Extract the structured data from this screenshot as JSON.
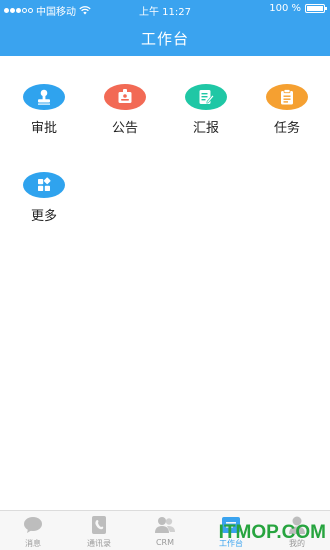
{
  "status_bar": {
    "carrier": "中国移动",
    "time": "上午 11:27",
    "battery": "100 %"
  },
  "header": {
    "title": "工作台"
  },
  "apps": [
    {
      "label": "审批",
      "icon": "stamp-icon",
      "color": "#2fa3ee"
    },
    {
      "label": "公告",
      "icon": "badge-icon",
      "color": "#f26a55"
    },
    {
      "label": "汇报",
      "icon": "report-icon",
      "color": "#1fc7a5"
    },
    {
      "label": "任务",
      "icon": "clipboard-icon",
      "color": "#f5a031"
    },
    {
      "label": "更多",
      "icon": "more-icon",
      "color": "#2fa3ee"
    }
  ],
  "tab_bar": {
    "active": "工作台",
    "tabs": [
      {
        "label": "消息",
        "icon": "chat-icon"
      },
      {
        "label": "通讯录",
        "icon": "contacts-icon"
      },
      {
        "label": "CRM",
        "icon": "crm-icon"
      },
      {
        "label": "工作台",
        "icon": "workbench-icon"
      },
      {
        "label": "我的",
        "icon": "profile-icon"
      }
    ]
  },
  "watermark": "ITMOP.COM"
}
